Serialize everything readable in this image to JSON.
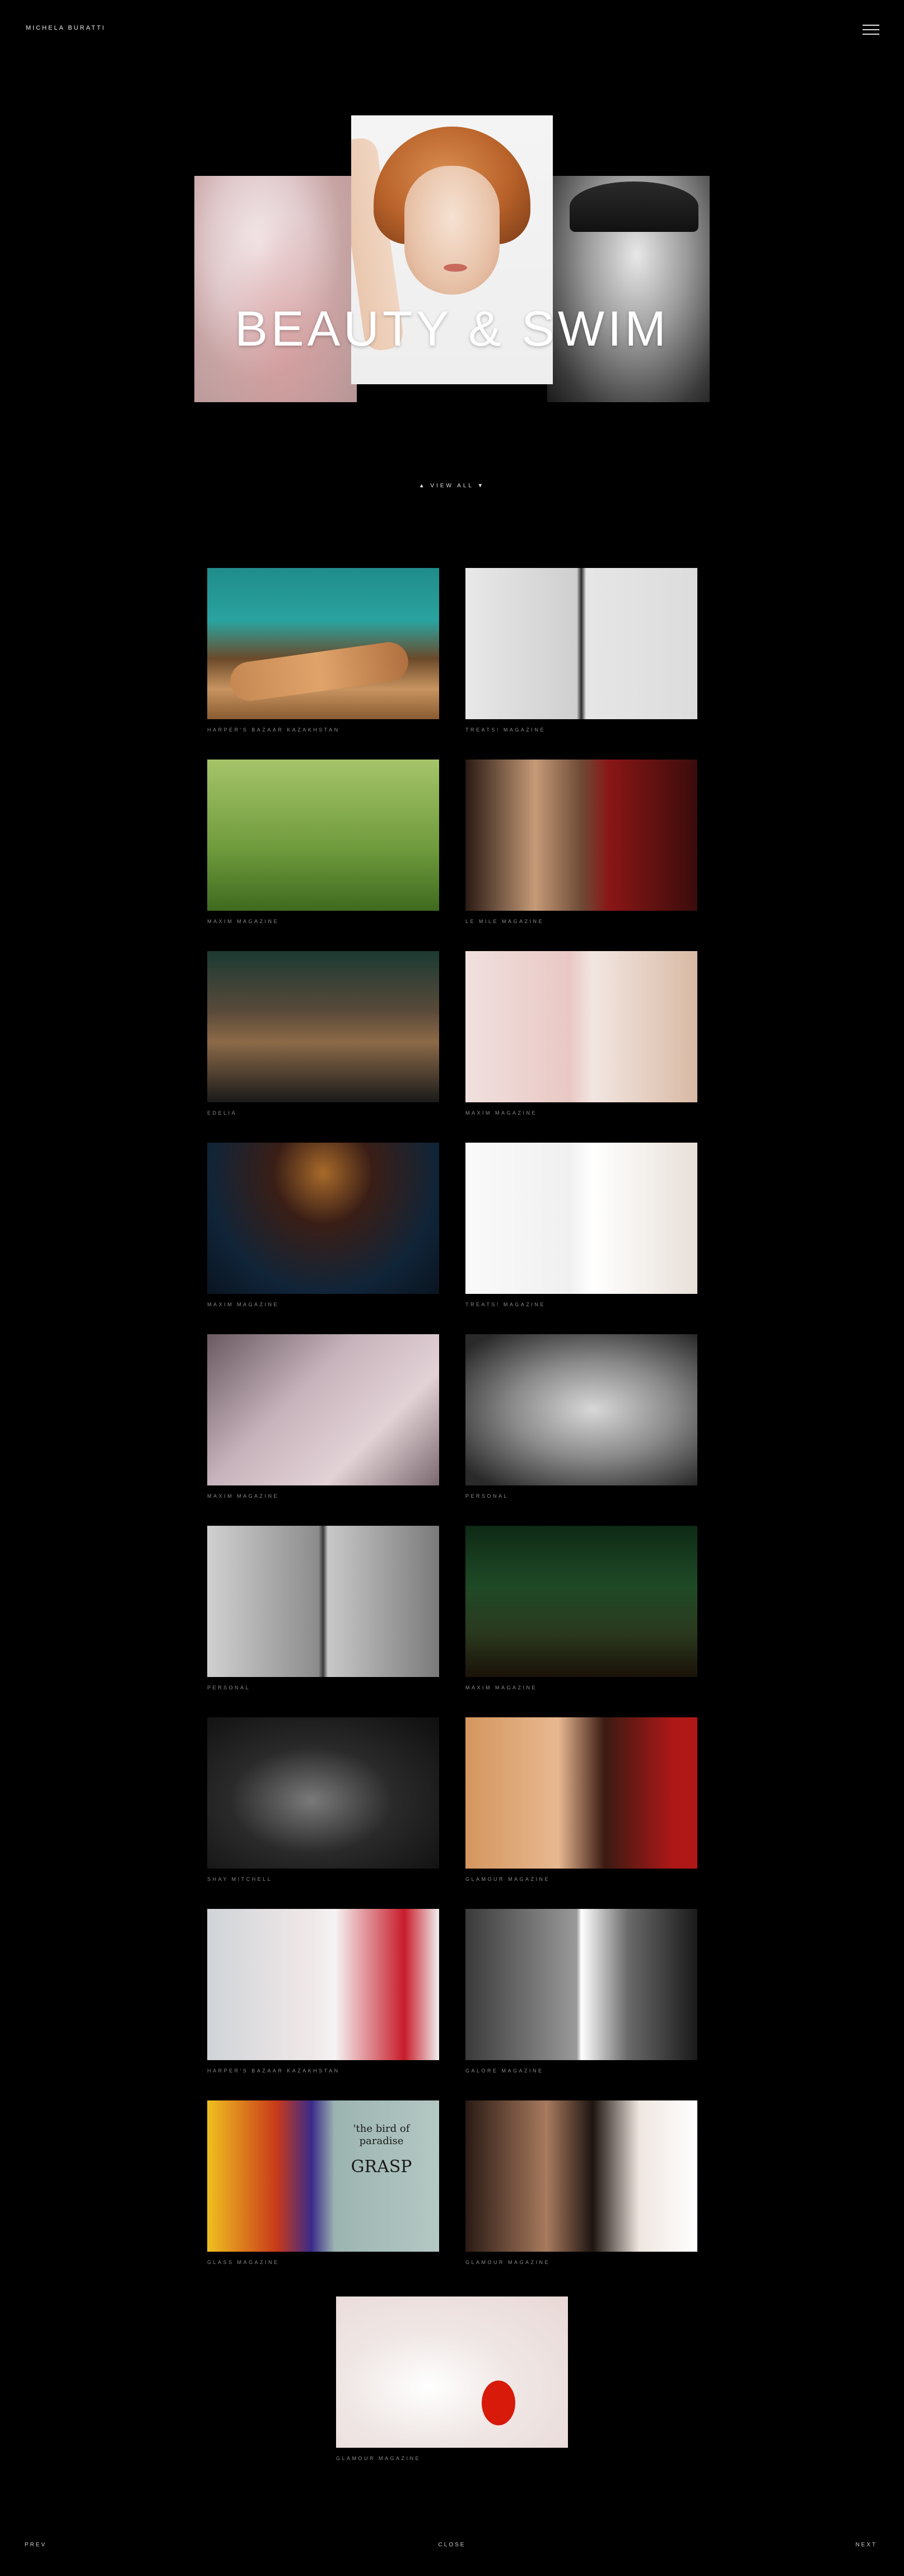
{
  "header": {
    "brand": "MICHELA BURATTI"
  },
  "hero": {
    "title": "BEAUTY & SWIM"
  },
  "view_all": "▲ VIEW ALL ▼",
  "gallery": [
    {
      "caption": "HARPER'S BAZAAR KAZAKHSTAN"
    },
    {
      "caption": "TREATS! MAGAZINE"
    },
    {
      "caption": "MAXIM MAGAZINE"
    },
    {
      "caption": "LE MILE MAGAZINE"
    },
    {
      "caption": "EDELIA"
    },
    {
      "caption": "MAXIM MAGAZINE"
    },
    {
      "caption": "MAXIM MAGAZINE"
    },
    {
      "caption": "TREATS! MAGAZINE"
    },
    {
      "caption": "MAXIM MAGAZINE"
    },
    {
      "caption": "PERSONAL"
    },
    {
      "caption": "PERSONAL"
    },
    {
      "caption": "MAXIM MAGAZINE"
    },
    {
      "caption": "SHAY MITCHELL"
    },
    {
      "caption": "GLAMOUR MAGAZINE"
    },
    {
      "caption": "HARPER'S BAZAAR KAZAKHSTAN"
    },
    {
      "caption": "GALORE MAGAZINE"
    },
    {
      "caption": "GLASS MAGAZINE"
    },
    {
      "caption": "GLAMOUR MAGAZINE"
    },
    {
      "caption": "GLAMOUR MAGAZINE"
    }
  ],
  "grasp_text": {
    "line1": "'the bird of paradise",
    "line2": "GRASP"
  },
  "footer": {
    "prev": "PREV",
    "close": "CLOSE",
    "next": "NEXT"
  }
}
